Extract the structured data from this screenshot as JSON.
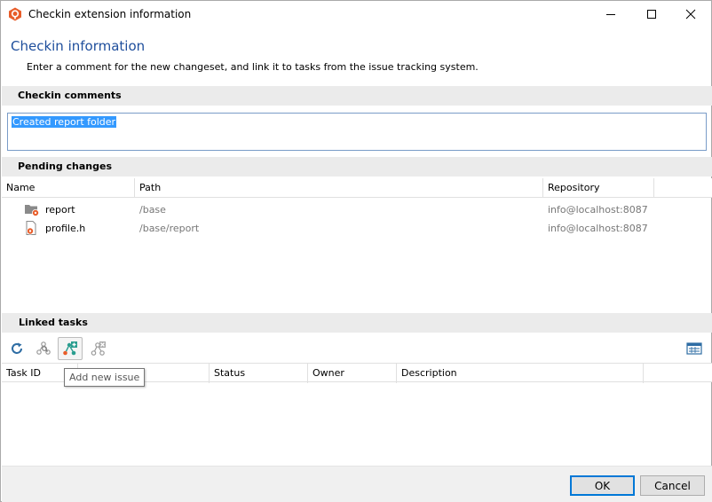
{
  "window": {
    "title": "Checkin extension information",
    "colors": {
      "accent": "#1e4e9c",
      "selection": "#3399ff",
      "app_icon": "#e85d2a"
    }
  },
  "header": {
    "title": "Checkin information",
    "description": "Enter a comment for the new changeset, and link it to tasks from the issue tracking system."
  },
  "comments": {
    "section_label": "Checkin comments",
    "value": "Created report folder"
  },
  "pending": {
    "section_label": "Pending changes",
    "columns": [
      "Name",
      "Path",
      "Repository"
    ],
    "rows": [
      {
        "name": "report",
        "path": "/base",
        "repository": "info@localhost:8087",
        "icon": "folder-pending-icon"
      },
      {
        "name": "profile.h",
        "path": "/base/report",
        "repository": "info@localhost:8087",
        "icon": "file-pending-icon"
      }
    ]
  },
  "tasks": {
    "section_label": "Linked tasks",
    "toolbar": {
      "icons": [
        "refresh-icon",
        "link-task-icon",
        "add-issue-icon",
        "unlink-task-icon",
        "table-view-icon"
      ],
      "tooltip": "Add new issue"
    },
    "columns": [
      "Task ID",
      "",
      "Status",
      "Owner",
      "Description"
    ]
  },
  "footer": {
    "ok_label": "OK",
    "cancel_label": "Cancel"
  }
}
